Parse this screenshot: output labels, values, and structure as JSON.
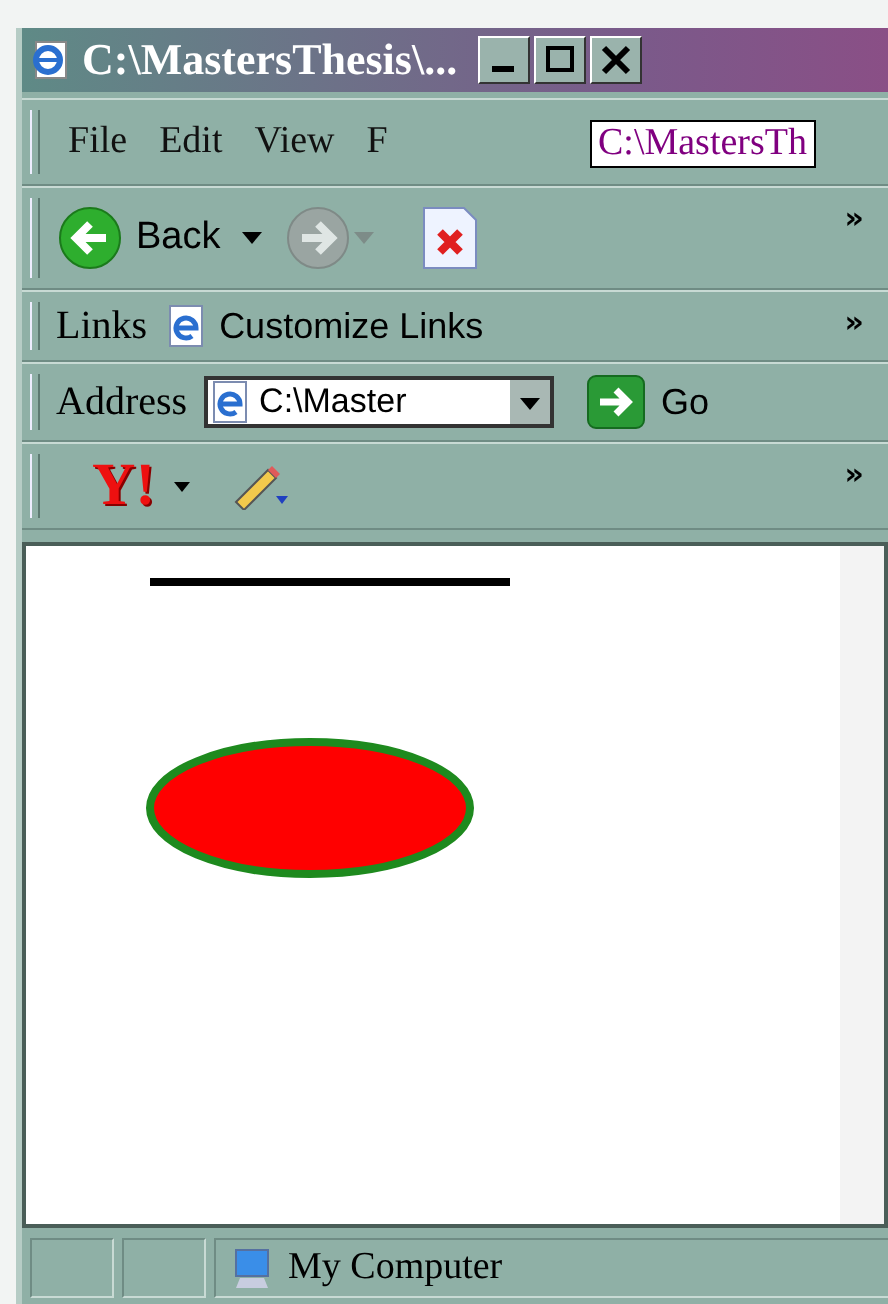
{
  "window": {
    "title": "C:\\MastersThesis\\..."
  },
  "menu_bar": {
    "items": [
      {
        "label": "File"
      },
      {
        "label": "Edit"
      },
      {
        "label": "View"
      },
      {
        "label": "F"
      }
    ],
    "tooltip": "C:\\MastersTh"
  },
  "toolbar": {
    "back": "Back",
    "more": "»"
  },
  "links_bar": {
    "label": "Links",
    "items": [
      "Customize Links"
    ],
    "more": "»"
  },
  "address_bar": {
    "label": "Address",
    "value": "C:\\Master",
    "go": "Go"
  },
  "yahoo_bar": {
    "logo": "Y!",
    "more": "»"
  },
  "status_bar": {
    "text": "My Computer"
  }
}
